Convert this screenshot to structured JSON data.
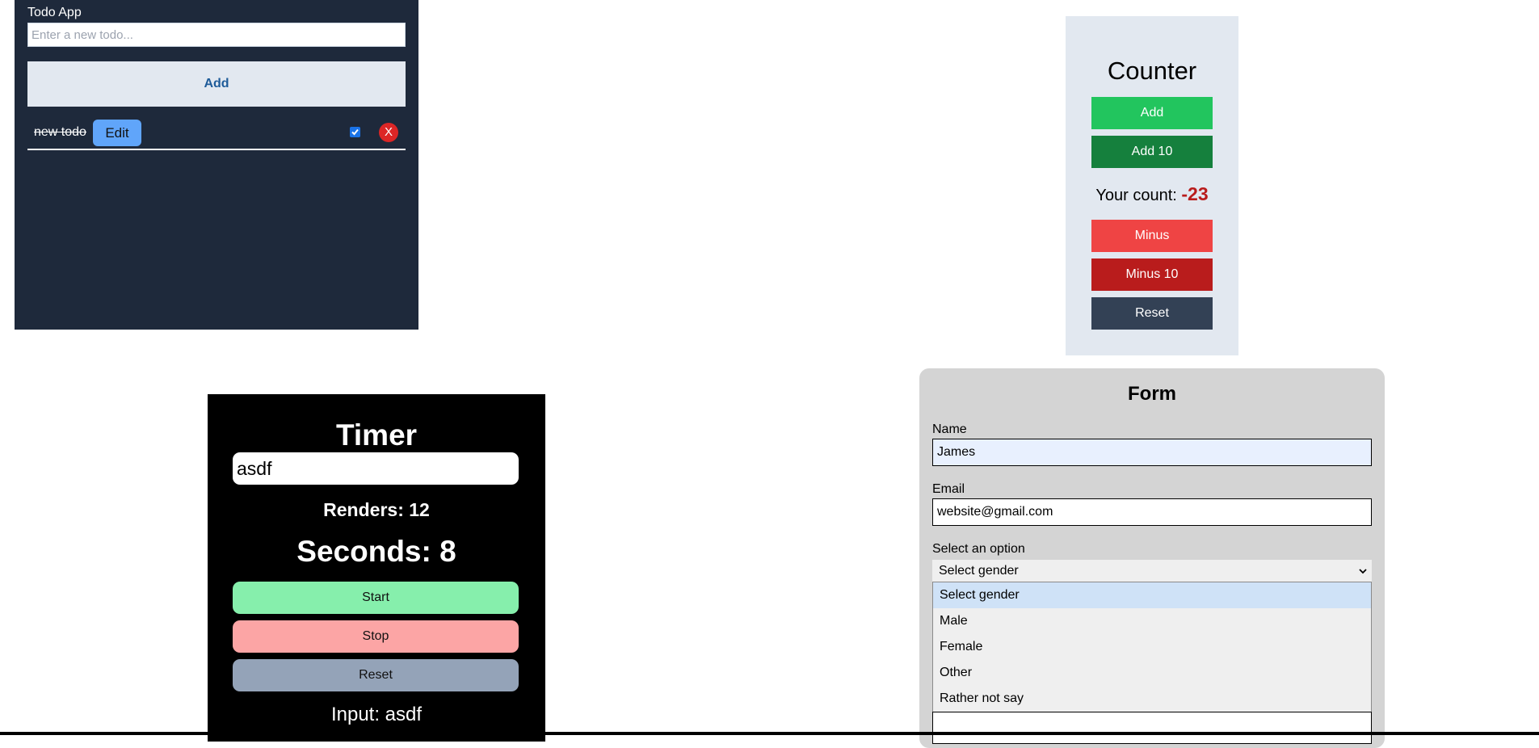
{
  "todo": {
    "title": "Todo App",
    "input_placeholder": "Enter a new todo...",
    "add_label": "Add",
    "items": [
      {
        "text": "new todo",
        "edit_label": "Edit",
        "completed": true,
        "delete_label": "X"
      }
    ]
  },
  "counter": {
    "title": "Counter",
    "add_label": "Add",
    "add10_label": "Add 10",
    "count_prefix": "Your count:",
    "count_value": "-23",
    "minus_label": "Minus",
    "minus10_label": "Minus 10",
    "reset_label": "Reset",
    "colors": {
      "add": "#22c55e",
      "add10": "#15803d",
      "minus": "#ef4444",
      "minus10": "#b91c1c",
      "reset": "#334155"
    }
  },
  "timer": {
    "title": "Timer",
    "input_value": "asdf",
    "renders_text": "Renders: 12",
    "seconds_text": "Seconds: 8",
    "start_label": "Start",
    "stop_label": "Stop",
    "reset_label": "Reset",
    "input_echo": "Input: asdf",
    "colors": {
      "start": "#86efac",
      "stop": "#fca5a5",
      "reset": "#94a3b8"
    }
  },
  "form": {
    "title": "Form",
    "name_label": "Name",
    "name_value": "James",
    "email_label": "Email",
    "email_value": "website@gmail.com",
    "select_label": "Select an option",
    "select_value": "Select gender",
    "options": [
      "Select gender",
      "Male",
      "Female",
      "Other",
      "Rather not say"
    ]
  }
}
